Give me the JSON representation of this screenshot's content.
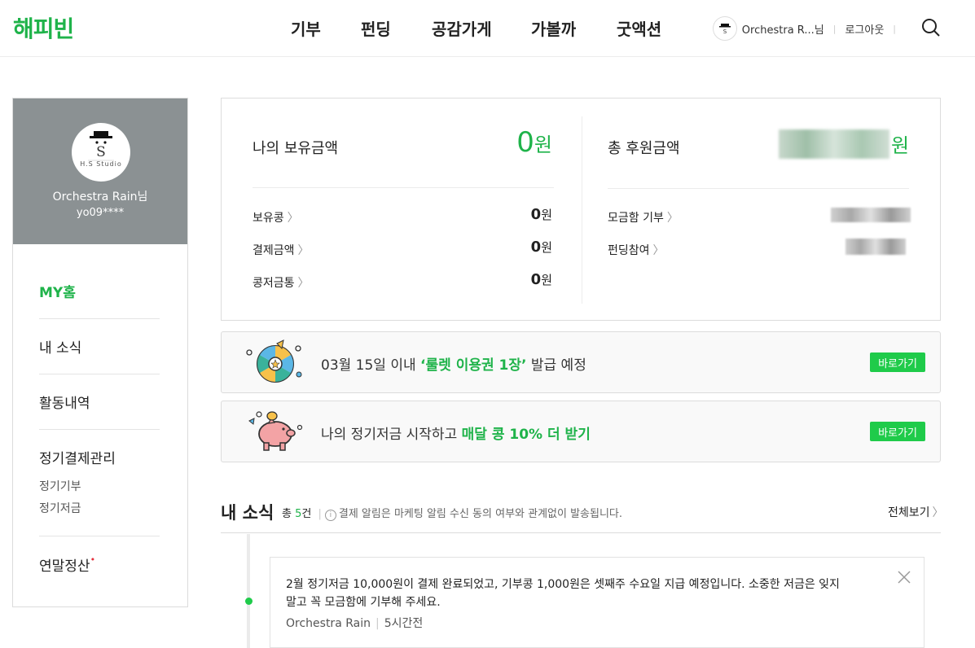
{
  "header": {
    "logo": "해피빈",
    "nav": [
      "기부",
      "펀딩",
      "공감가게",
      "가볼까",
      "굿액션"
    ],
    "user_name": "Orchestra R...님",
    "logout": "로그아웃"
  },
  "sidebar": {
    "avatar_text": "H.S Studio",
    "user_name": "Orchestra Rain님",
    "user_id": "yo09****",
    "menu": {
      "my_home": "MY홈",
      "my_news": "내 소식",
      "activity": "활동내역",
      "regular_payment": "정기결제관리",
      "regular_donation": "정기기부",
      "regular_saving": "정기저금",
      "year_end": "연말정산",
      "year_end_badge": "•"
    }
  },
  "summary": {
    "holding_title": "나의 보유금액",
    "holding_amount": "0",
    "won": "원",
    "rows": [
      {
        "label": "보유콩",
        "value": "0"
      },
      {
        "label": "결제금액",
        "value": "0"
      },
      {
        "label": "콩저금통",
        "value": "0"
      }
    ],
    "total_title": "총 후원금액",
    "total_rows": [
      {
        "label": "모금함 기부"
      },
      {
        "label": "펀딩참여"
      }
    ]
  },
  "banners": [
    {
      "pre": "03월 15일 이내 ",
      "highlight": "‘룰렛 이용권 1장’",
      "post": " 발급 예정",
      "button": "바로가기"
    },
    {
      "pre": "나의 정기저금 시작하고 ",
      "highlight": "매달 콩 10% 더 받기",
      "post": "",
      "button": "바로가기"
    }
  ],
  "news": {
    "title": "내 소식",
    "count_prefix": "총 ",
    "count": "5",
    "count_suffix": "건",
    "notice": "결제 알림은 마케팅 알림 수신 동의 여부와 관계없이 발송됩니다.",
    "view_all": "전체보기",
    "items": [
      {
        "text": "2월 정기저금 10,000원이 결제 완료되었고, 기부콩 1,000원은 셋째주 수요일 지급 예정입니다. 소중한 저금은 잊지 말고 꼭 모금함에 기부해 주세요.",
        "author": "Orchestra Rain",
        "time": "5시간전"
      }
    ]
  },
  "colors": {
    "accent": "#1fb34a",
    "button": "#1fcb4a",
    "sidebar_profile": "#8b9193"
  }
}
